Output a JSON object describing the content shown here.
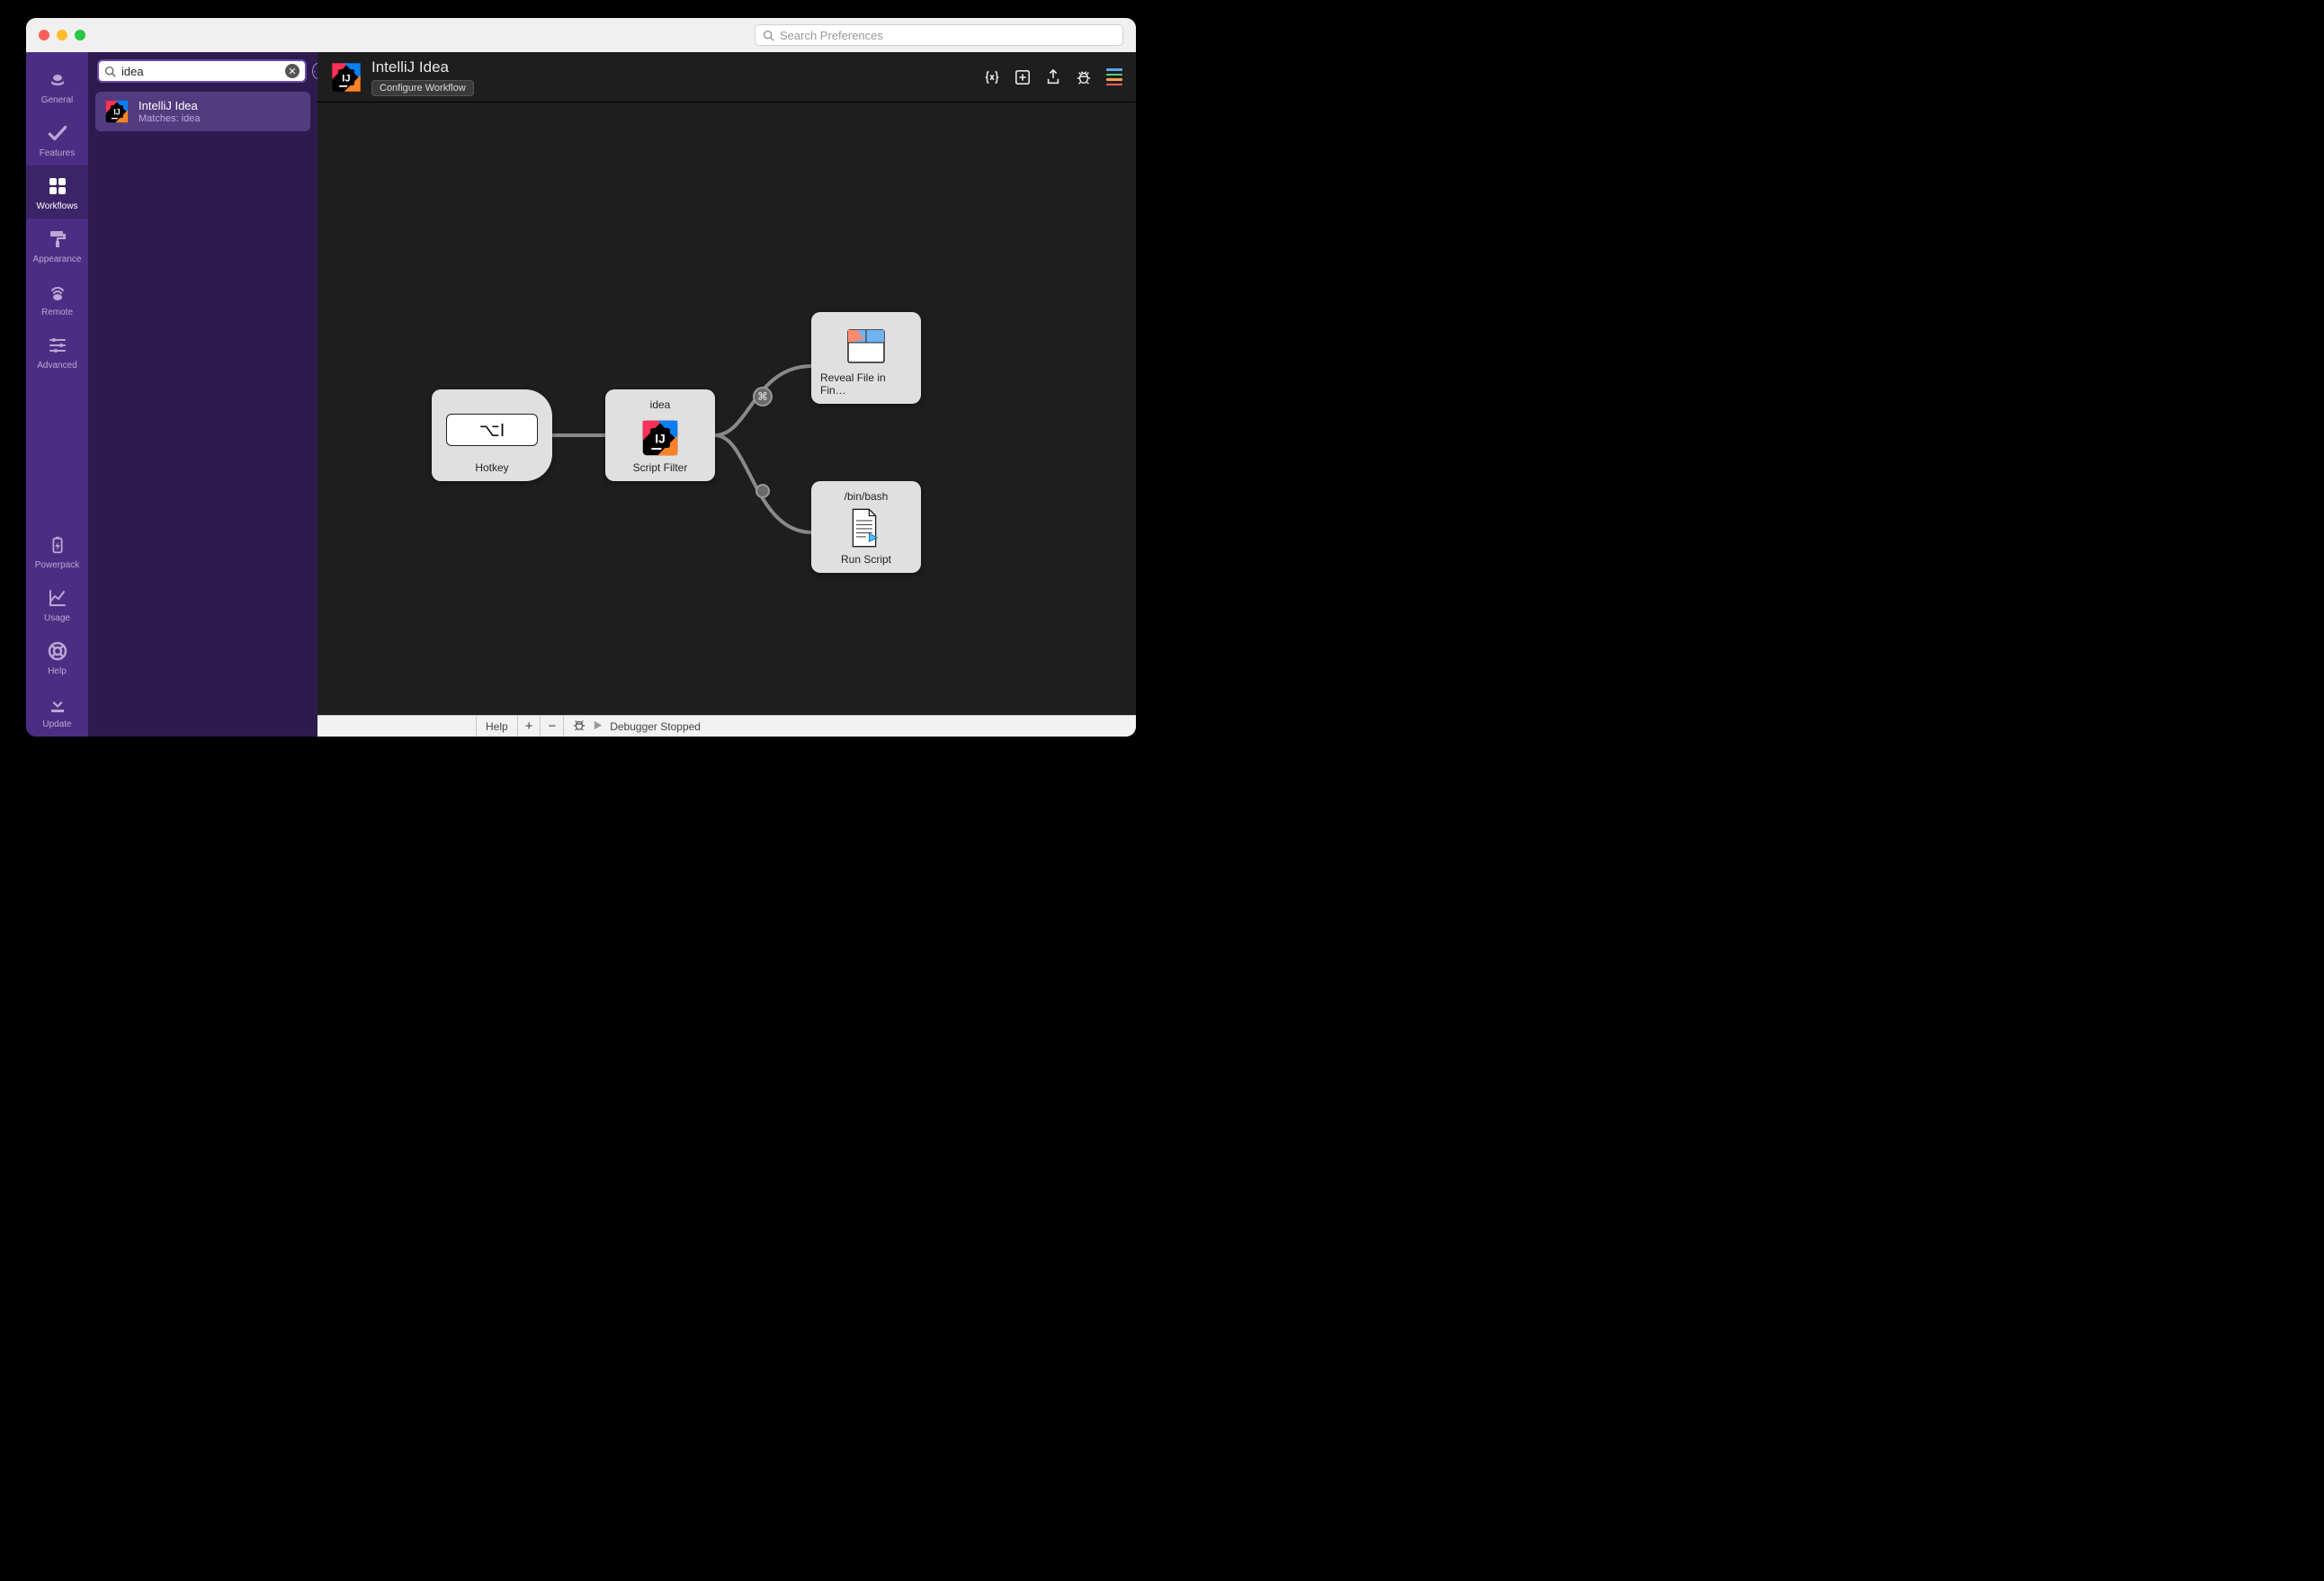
{
  "titlebar": {
    "search_placeholder": "Search Preferences"
  },
  "sidebar": {
    "items": [
      {
        "label": "General"
      },
      {
        "label": "Features"
      },
      {
        "label": "Workflows"
      },
      {
        "label": "Appearance"
      },
      {
        "label": "Remote"
      },
      {
        "label": "Advanced"
      },
      {
        "label": "Powerpack"
      },
      {
        "label": "Usage"
      },
      {
        "label": "Help"
      },
      {
        "label": "Update"
      }
    ]
  },
  "list": {
    "search_value": "idea",
    "item": {
      "title": "IntelliJ Idea",
      "subtitle": "Matches: idea"
    }
  },
  "header": {
    "title": "IntelliJ Idea",
    "configure_label": "Configure Workflow"
  },
  "nodes": {
    "hotkey": {
      "label": "Hotkey",
      "symbol": "⌥I"
    },
    "script_filter": {
      "top": "idea",
      "label": "Script Filter"
    },
    "reveal": {
      "label": "Reveal File in Fin…"
    },
    "run_script": {
      "top": "/bin/bash",
      "label": "Run Script"
    },
    "modifier_cmd": "⌘"
  },
  "footer": {
    "help": "Help",
    "debugger": "Debugger Stopped"
  }
}
